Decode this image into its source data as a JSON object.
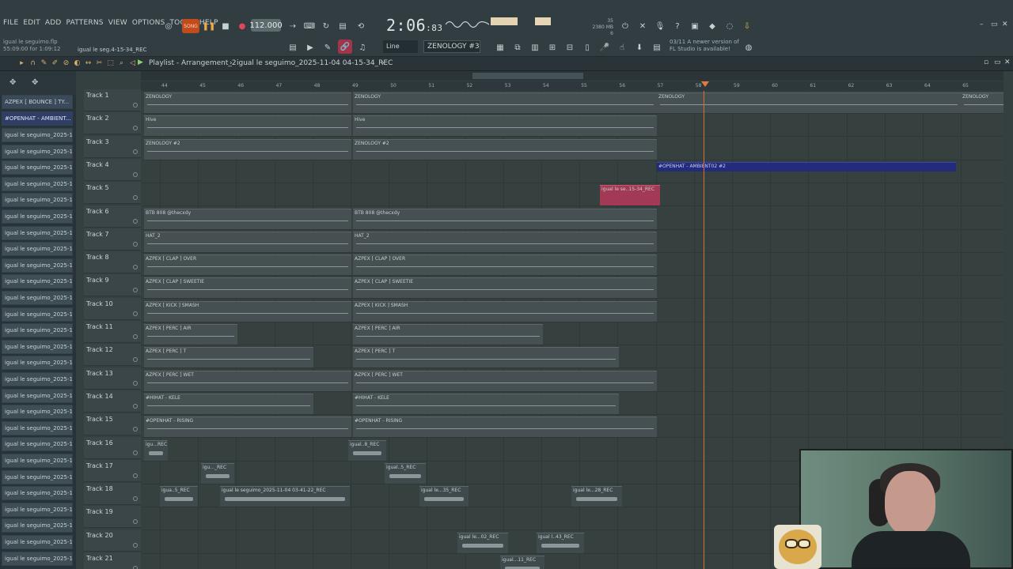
{
  "menu": [
    "FILE",
    "EDIT",
    "ADD",
    "PATTERNS",
    "VIEW",
    "OPTIONS",
    "TOOLS",
    "HELP"
  ],
  "hint": {
    "line1": "igual le seguimo.flp",
    "line2": "55:09:00 for 1:09:12",
    "file_short": "igual le seg.4-15-34_REC"
  },
  "transport": {
    "song_label": "SONG",
    "tempo": "112.000",
    "time_main": "2:06",
    "time_sub": ":83"
  },
  "perf": {
    "cpu": "35",
    "mem": "2380 MB",
    "voices": "6"
  },
  "snap": {
    "value": "Line"
  },
  "pattern": {
    "name": "ZENOLOGY #3"
  },
  "update_msg": {
    "line1": "03/11  A newer version of",
    "line2": "FL Studio is available!"
  },
  "playlist": {
    "title": "Playlist - Arrangement_2",
    "arrow": "›",
    "file": "igual le seguimo_2025-11-04 04-15-34_REC",
    "arrow2": "›"
  },
  "picker": {
    "header1": "AZPEX [ BOUNCE ] TY...",
    "header2": "#OPENHAT - AMBIENT...",
    "item": "igual le seguimo_2025-1..."
  },
  "ruler": [
    "44",
    "45",
    "46",
    "47",
    "48",
    "49",
    "50",
    "51",
    "52",
    "53",
    "54",
    "55",
    "56",
    "57",
    "58",
    "59",
    "60",
    "61",
    "62",
    "63",
    "64",
    "65"
  ],
  "tracks": [
    "Track 1",
    "Track 2",
    "Track 3",
    "Track 4",
    "Track 5",
    "Track 6",
    "Track 7",
    "Track 8",
    "Track 9",
    "Track 10",
    "Track 11",
    "Track 12",
    "Track 13",
    "Track 14",
    "Track 15",
    "Track 16",
    "Track 17",
    "Track 18",
    "Track 19",
    "Track 20",
    "Track 21"
  ],
  "clips": {
    "zen1": "ZENOLOGY",
    "zen2": "ZENOLOGY",
    "zen3": "ZENOLOGY",
    "zen4": "ZENOLOGY",
    "hive1": "Hive",
    "hive2": "Hive",
    "zen3a": "ZENOLOGY #2",
    "zen3b": "ZENOLOGY #2",
    "openhat_amb": "#OPENHAT - AMBIENT02 #2",
    "rec5": "igual le se..15-34_REC",
    "bass1": "BTB 808 @thecxdy",
    "bass2": "BTB 808 @thecxdy",
    "hat1": "HAT_2",
    "hat2": "HAT_2",
    "clap1": "AZPEX [ CLAP ] OVER",
    "clap2": "AZPEX [ CLAP ] OVER",
    "clap3": "AZPEX [ CLAP ] SWEETIE",
    "clap4": "AZPEX [ CLAP ] SWEETIE",
    "kick1": "AZPEX [ KICK ] SMASH",
    "kick2": "AZPEX [ KICK ] SMASH",
    "perc1": "AZPEX [ PERC ] AIR",
    "perc2": "AZPEX [ PERC ] AIR",
    "perc3": "AZPEX [ PERC ] T",
    "perc4": "AZPEX [ PERC ] T",
    "perc5": "AZPEX [ PERC ] WET",
    "perc6": "AZPEX [ PERC ] WET",
    "hihat1": "#HIHAT - KELE",
    "hihat2": "#HIHAT - KELE",
    "oh1": "#OPENHAT - RISING",
    "oh2": "#OPENHAT - RISING",
    "r16a": "igu...REC",
    "r16b": "igual..8_REC",
    "r17a": "igu..._REC",
    "r17b": "igual..5_REC",
    "r18a": "igua..5_REC",
    "r18b": "igual le seguimo_2025-11-04 03-41-22_REC",
    "r18c": "igual le...35_REC",
    "r18d": "igual le...28_REC",
    "r20a": "igual le...02_REC",
    "r20b": "igual l..43_REC",
    "r21a": "igual...11_REC"
  }
}
